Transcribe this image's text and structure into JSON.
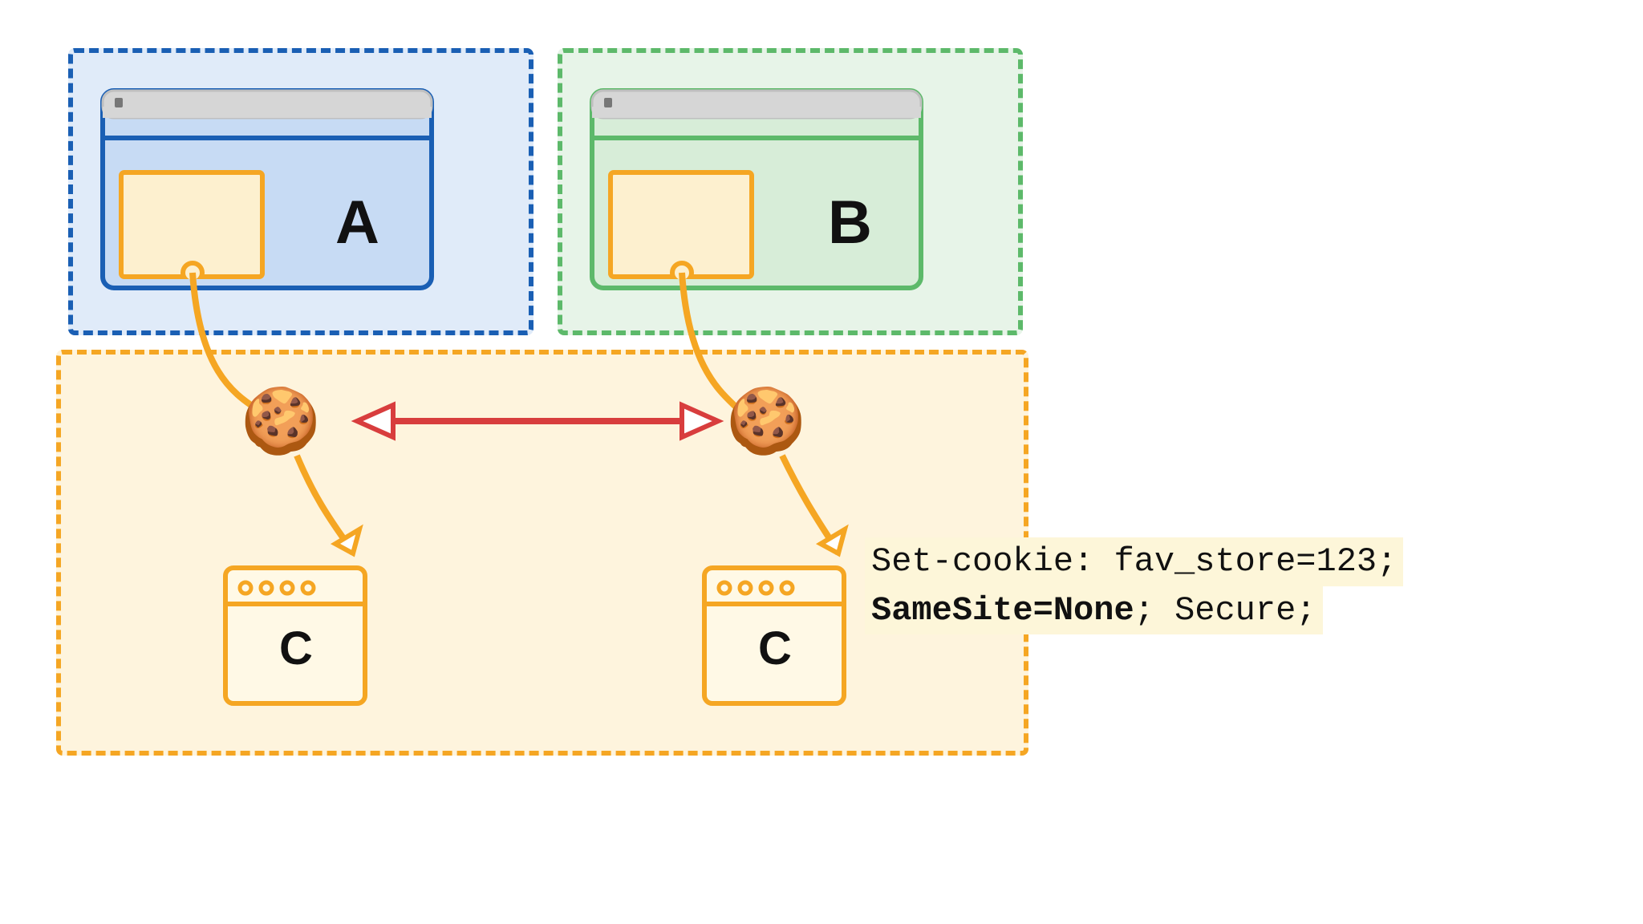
{
  "sites": {
    "a": {
      "label": "A"
    },
    "b": {
      "label": "B"
    }
  },
  "shared": {
    "c1": {
      "label": "C"
    },
    "c2": {
      "label": "C"
    }
  },
  "code": {
    "line1": "Set-cookie: fav_store=123;",
    "line2_bold": "SameSite=None",
    "line2_rest": "; Secure;"
  },
  "colors": {
    "blue_stroke": "#1a5fb4",
    "blue_fill": "#c7dbf4",
    "green_stroke": "#5db96a",
    "green_fill": "#d7edd8",
    "orange_stroke": "#f5a623",
    "orange_fill": "#fdf0cf",
    "orange_fill2": "#fff9e6",
    "red": "#d83d3d",
    "gray": "#d6d6d6",
    "gray_stroke": "#bfbfbf"
  }
}
